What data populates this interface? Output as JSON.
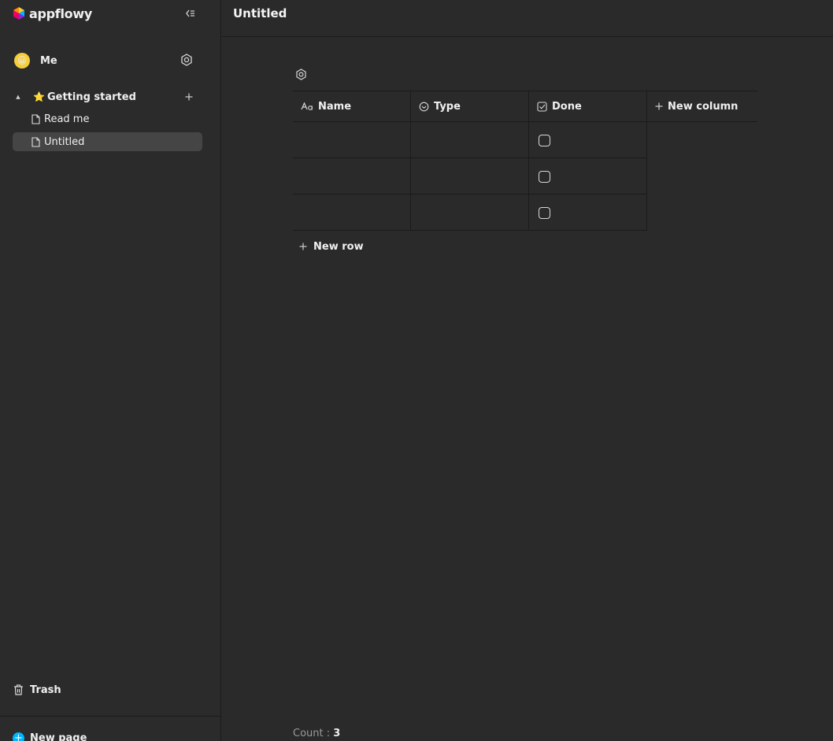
{
  "app": {
    "logo_text": "appflowy",
    "collapse_icon": "collapse-sidebar-icon"
  },
  "user": {
    "name": "Me",
    "avatar": "😀"
  },
  "sidebar": {
    "section": {
      "emoji": "⭐",
      "label": "Getting started",
      "expanded": true
    },
    "pages": [
      {
        "label": "Read me",
        "active": false
      },
      {
        "label": "Untitled",
        "active": true
      }
    ],
    "trash_label": "Trash",
    "new_page_label": "New page"
  },
  "page": {
    "title": "Untitled"
  },
  "grid": {
    "columns": [
      {
        "label": "Name",
        "icon": "text-type-icon"
      },
      {
        "label": "Type",
        "icon": "single-select-icon"
      },
      {
        "label": "Done",
        "icon": "checkbox-type-icon"
      }
    ],
    "new_column_label": "New column",
    "rows": [
      {
        "name": "",
        "type": "",
        "done": false
      },
      {
        "name": "",
        "type": "",
        "done": false
      },
      {
        "name": "",
        "type": "",
        "done": false
      }
    ],
    "new_row_label": "New row",
    "count_label": "Count : ",
    "count_value": "3"
  },
  "colors": {
    "background": "#2a2a2a",
    "active_item": "#454545",
    "accent": "#00b5ff"
  }
}
